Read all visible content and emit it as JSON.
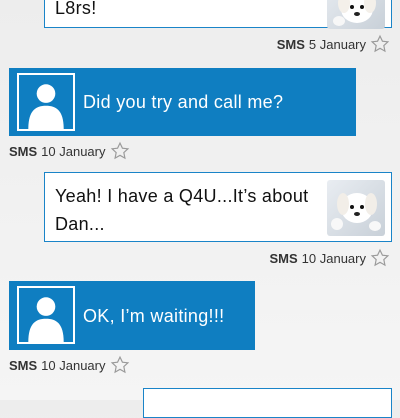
{
  "colors": {
    "incoming_bg": "#0f7ec1",
    "outgoing_border": "#1a84c8",
    "background": "#efefef"
  },
  "messages": [
    {
      "direction": "outgoing",
      "text": "L8rs!",
      "meta": {
        "type": "SMS",
        "date": "5 January"
      },
      "thumbnail_icon": "puppy-avatar-icon",
      "star_icon": "star-outline-icon"
    },
    {
      "direction": "incoming",
      "text": "Did you try and call me?",
      "meta": {
        "type": "SMS",
        "date": "10 January"
      },
      "avatar_icon": "person-silhouette-icon",
      "star_icon": "star-outline-icon"
    },
    {
      "direction": "outgoing",
      "text_line1": "Yeah! I have a Q4U...It’s about",
      "text_line2": "Dan...",
      "meta": {
        "type": "SMS",
        "date": "10 January"
      },
      "thumbnail_icon": "puppy-avatar-icon",
      "star_icon": "star-outline-icon"
    },
    {
      "direction": "incoming",
      "text": "OK, I’m waiting!!!",
      "meta": {
        "type": "SMS",
        "date": "10 January"
      },
      "avatar_icon": "person-silhouette-icon",
      "star_icon": "star-outline-icon"
    }
  ]
}
